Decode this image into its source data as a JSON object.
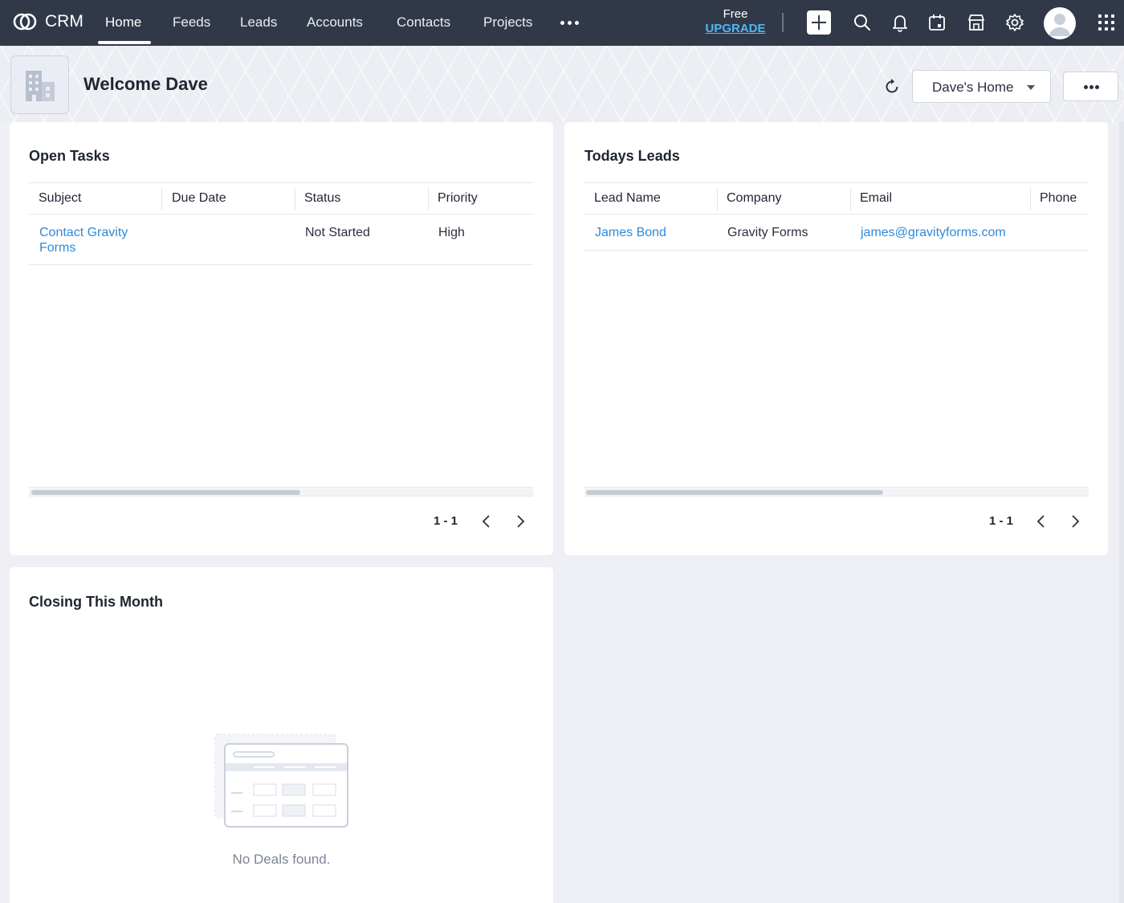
{
  "topbar": {
    "app_name": "CRM",
    "nav": [
      "Home",
      "Feeds",
      "Leads",
      "Accounts",
      "Contacts",
      "Projects"
    ],
    "active_nav": "Home",
    "plan_label": "Free",
    "upgrade_label": "UPGRADE",
    "accent_color": "#4fb8f3",
    "background_color": "#313949",
    "icons": [
      "create-plus-icon",
      "search-icon",
      "bell-icon",
      "calendar-icon",
      "marketplace-icon",
      "gear-icon",
      "avatar",
      "apps-grid-icon"
    ]
  },
  "header": {
    "welcome": "Welcome Dave",
    "home_select": "Dave's Home"
  },
  "open_tasks": {
    "title": "Open Tasks",
    "columns": [
      "Subject",
      "Due Date",
      "Status",
      "Priority"
    ],
    "rows": [
      {
        "subject_line1": "Contact Gravity",
        "subject_line2": "Forms",
        "due_date": "",
        "status": "Not Started",
        "priority": "High"
      }
    ],
    "pager": "1 - 1"
  },
  "todays_leads": {
    "title": "Todays Leads",
    "columns": [
      "Lead Name",
      "Company",
      "Email",
      "Phone"
    ],
    "rows": [
      {
        "lead_name": "James Bond",
        "company": "Gravity Forms",
        "email": "james@gravityforms.com",
        "phone": ""
      }
    ],
    "pager": "1 - 1"
  },
  "closing_this_month": {
    "title": "Closing This Month",
    "empty_message": "No Deals found."
  }
}
